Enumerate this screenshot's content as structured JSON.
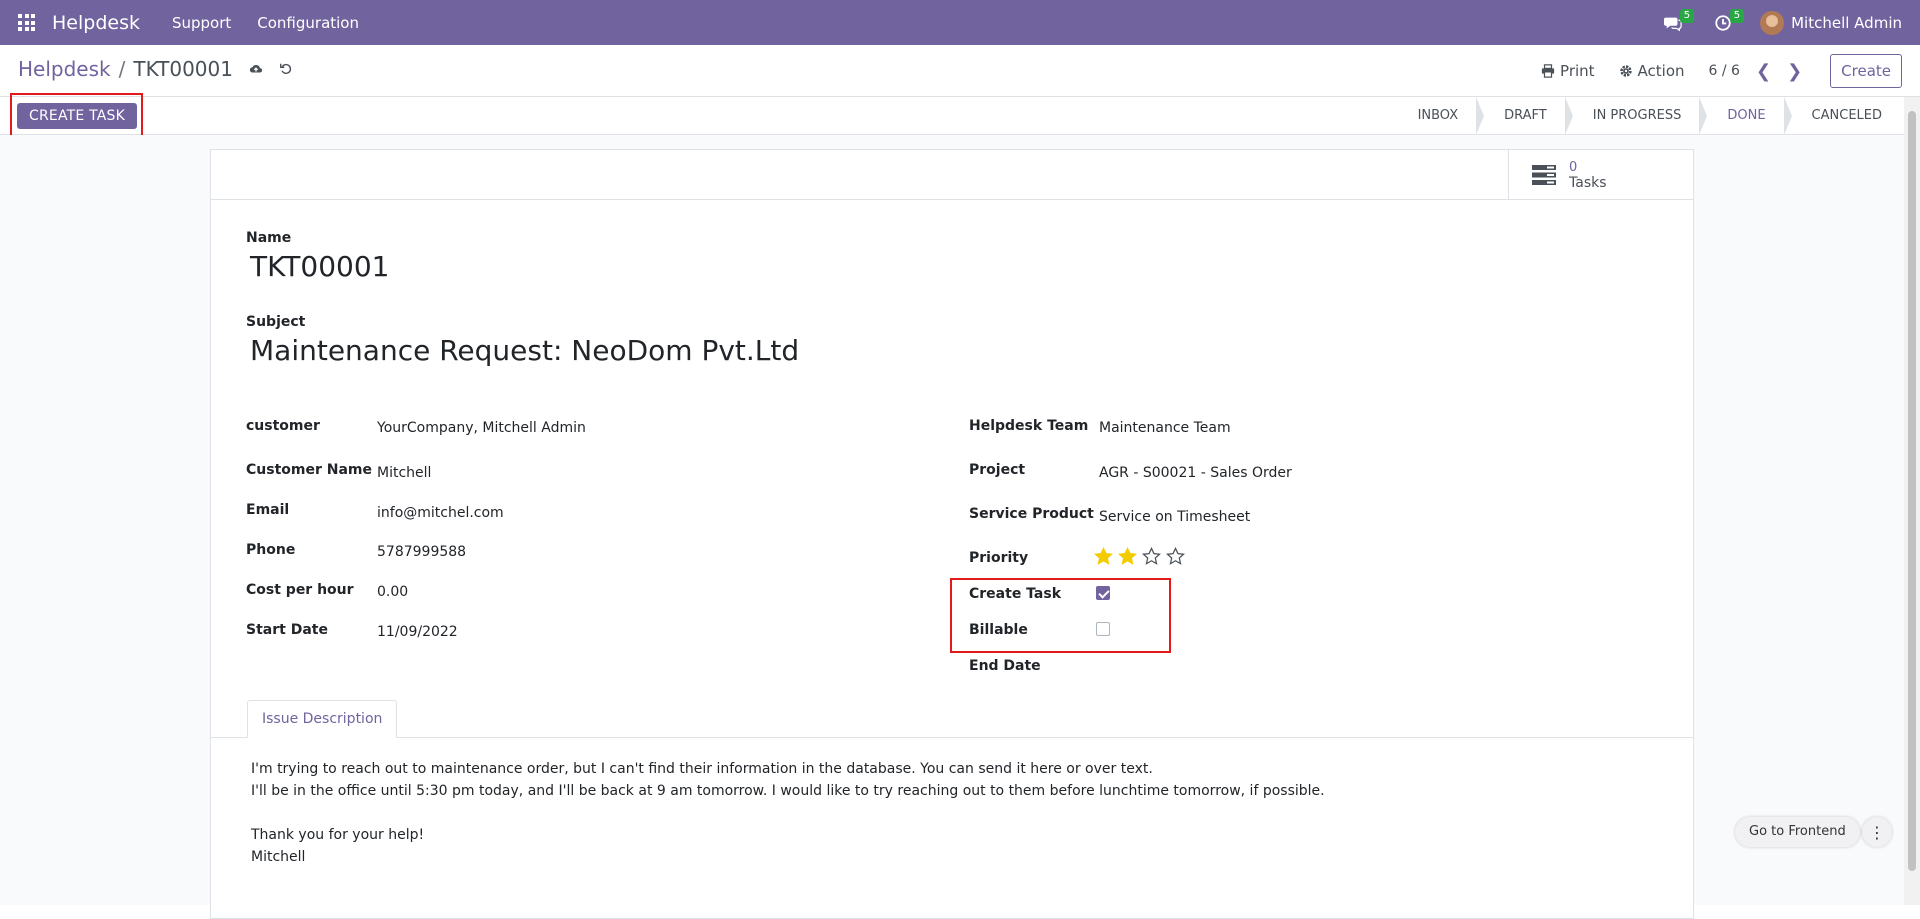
{
  "navbar": {
    "brand": "Helpdesk",
    "menus": [
      "Support",
      "Configuration"
    ],
    "messages_badge": "5",
    "activities_badge": "5",
    "user_name": "Mitchell Admin"
  },
  "control_panel": {
    "breadcrumb_parent": "Helpdesk",
    "breadcrumb_sep": "/",
    "breadcrumb_current": "TKT00001",
    "print_label": "Print",
    "action_label": "Action",
    "pager": "6 / 6",
    "create_label": "Create"
  },
  "statusbar": {
    "create_task_label": "CREATE TASK",
    "stages": [
      "INBOX",
      "DRAFT",
      "IN PROGRESS",
      "DONE",
      "CANCELED"
    ],
    "active_stage": "DONE"
  },
  "smart_button": {
    "value": "0",
    "label": "Tasks"
  },
  "form": {
    "name_label": "Name",
    "name_value": "TKT00001",
    "subject_label": "Subject",
    "subject_value": "Maintenance Request: NeoDom Pvt.Ltd",
    "left": {
      "customer_label": "customer",
      "customer_value": "YourCompany, Mitchell Admin",
      "customer_name_label": "Customer Name",
      "customer_name_value": "Mitchell",
      "email_label": "Email",
      "email_value": "info@mitchel.com",
      "phone_label": "Phone",
      "phone_value": "5787999588",
      "cost_label": "Cost per hour",
      "cost_value": "0.00",
      "start_date_label": "Start Date",
      "start_date_value": "11/09/2022"
    },
    "right": {
      "team_label": "Helpdesk Team",
      "team_value": "Maintenance Team",
      "project_label": "Project",
      "project_value": "AGR - S00021 - Sales Order",
      "service_label": "Service Product",
      "service_value": "Service on Timesheet",
      "priority_label": "Priority",
      "priority_value": 2,
      "priority_max": 4,
      "create_task_label": "Create Task",
      "create_task_checked": true,
      "billable_label": "Billable",
      "billable_checked": false,
      "end_date_label": "End Date"
    }
  },
  "notebook": {
    "tab_label": "Issue Description",
    "lines": [
      "I'm trying to reach out to maintenance order, but I can't find their information in the database. You can send it here or over text.",
      "I'll be in the office until 5:30 pm today, and I'll be back at 9 am tomorrow. I would like to try reaching out to them before lunchtime tomorrow, if possible.",
      "",
      "Thank you for your help!",
      "Mitchell"
    ]
  },
  "floating": {
    "frontend_label": "Go to Frontend"
  },
  "colors": {
    "brand": "#71639e",
    "highlight": "#e21a1a",
    "star": "#f3cc00"
  }
}
